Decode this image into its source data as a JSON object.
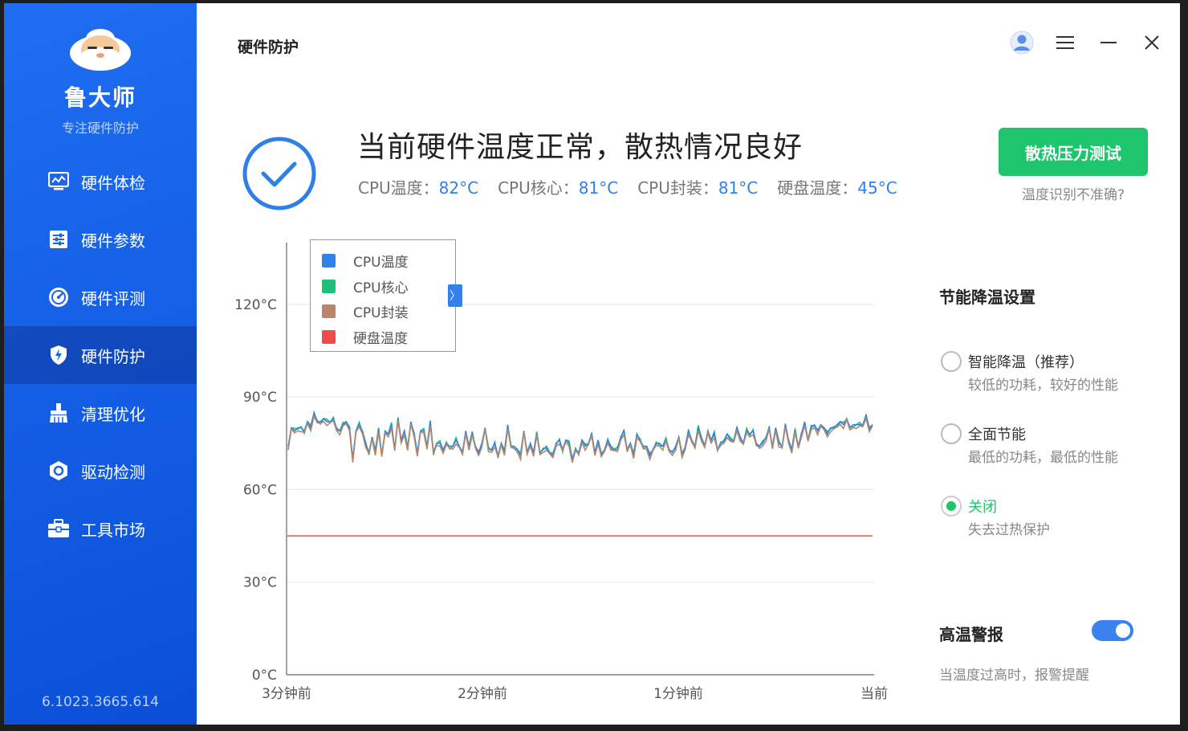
{
  "sidebar": {
    "brand_name": "鲁大师",
    "brand_sub": "专注硬件防护",
    "items": [
      {
        "label": "硬件体检",
        "icon": "monitor-icon"
      },
      {
        "label": "硬件参数",
        "icon": "sliders-icon"
      },
      {
        "label": "硬件评测",
        "icon": "speedometer-icon"
      },
      {
        "label": "硬件防护",
        "icon": "shield-bolt-icon",
        "active": true
      },
      {
        "label": "清理优化",
        "icon": "broom-icon"
      },
      {
        "label": "驱动检测",
        "icon": "gear-hex-icon"
      },
      {
        "label": "工具市场",
        "icon": "toolbox-icon"
      }
    ],
    "version": "6.1023.3665.614"
  },
  "header": {
    "title": "硬件防护"
  },
  "status": {
    "headline": "当前硬件温度正常，散热情况良好",
    "readings": [
      {
        "label": "CPU温度：",
        "value": "82°C"
      },
      {
        "label": "CPU核心：",
        "value": "81°C"
      },
      {
        "label": "CPU封装：",
        "value": "81°C"
      },
      {
        "label": "硬盘温度：",
        "value": "45°C"
      }
    ],
    "stress_button": "散热压力测试",
    "inaccurate_link": "温度识别不准确?"
  },
  "colors": {
    "accent": "#2f7fe8",
    "green": "#1dc66c",
    "cpu_temp": "#2f82e6",
    "cpu_core": "#1cc07a",
    "cpu_package": "#b8876a",
    "disk_temp": "#f04b4b"
  },
  "chart_data": {
    "type": "line",
    "x": [
      "3分钟前",
      "2分钟前",
      "1分钟前",
      "当前"
    ],
    "ylim": [
      0,
      140
    ],
    "yticks": [
      "0°C",
      "30°C",
      "60°C",
      "90°C",
      "120°C"
    ],
    "ytick_values": [
      0,
      30,
      60,
      90,
      120
    ],
    "grid": true,
    "legend": "top-left",
    "series": [
      {
        "name": "CPU温度",
        "color": "#2f82e6"
      },
      {
        "name": "CPU核心",
        "color": "#1cc07a"
      },
      {
        "name": "CPU封装",
        "color": "#b8876a"
      },
      {
        "name": "硬盘温度",
        "color": "#f04b4b",
        "constant": 45
      }
    ],
    "cpu_samples": [
      74,
      80,
      79,
      80,
      80,
      79,
      82,
      80,
      85,
      82,
      82,
      83,
      82,
      82,
      83,
      80,
      79,
      81,
      82,
      80,
      70,
      79,
      81,
      79,
      75,
      72,
      77,
      72,
      80,
      71,
      79,
      78,
      81,
      73,
      83,
      76,
      79,
      73,
      82,
      78,
      72,
      79,
      79,
      74,
      82,
      72,
      75,
      75,
      73,
      75,
      74,
      74,
      76,
      74,
      72,
      79,
      74,
      78,
      74,
      72,
      75,
      80,
      73,
      73,
      75,
      71,
      75,
      72,
      81,
      74,
      74,
      73,
      71,
      79,
      72,
      75,
      72,
      78,
      72,
      73,
      74,
      72,
      71,
      75,
      76,
      73,
      76,
      75,
      70,
      73,
      72,
      76,
      74,
      75,
      78,
      72,
      76,
      71,
      73,
      76,
      74,
      73,
      73,
      77,
      79,
      73,
      75,
      71,
      78,
      76,
      74,
      74,
      71,
      73,
      75,
      75,
      74,
      76,
      73,
      72,
      74,
      77,
      71,
      74,
      79,
      76,
      74,
      80,
      77,
      74,
      79,
      76,
      78,
      73,
      75,
      76,
      78,
      76,
      76,
      80,
      77,
      75,
      79,
      78,
      79,
      75,
      74,
      75,
      77,
      80,
      74,
      80,
      75,
      74,
      81,
      76,
      73,
      79,
      74,
      78,
      82,
      76,
      80,
      81,
      79,
      81,
      80,
      78,
      80,
      80,
      81,
      82,
      81,
      83,
      80,
      81,
      81,
      81,
      81,
      84,
      80,
      81
    ]
  },
  "settings": {
    "title": "节能降温设置",
    "options": [
      {
        "label": "智能降温（推荐）",
        "desc": "较低的功耗，较好的性能",
        "checked": false
      },
      {
        "label": "全面节能",
        "desc": "最低的功耗，最低的性能",
        "checked": false
      },
      {
        "label": "关闭",
        "desc": "失去过热保护",
        "checked": true
      }
    ],
    "alarm_title": "高温警报",
    "alarm_desc": "当温度过高时，报警提醒",
    "alarm_on": true
  }
}
